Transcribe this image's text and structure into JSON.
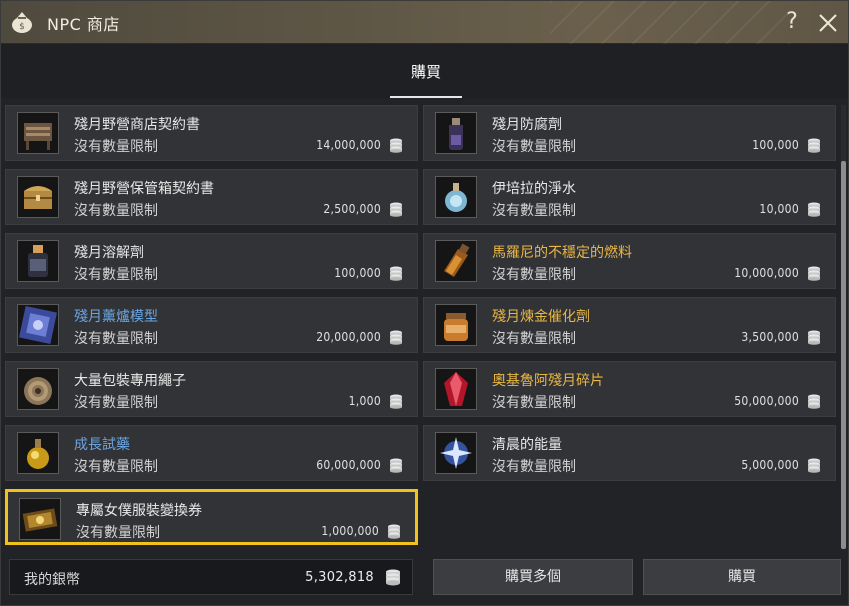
{
  "window": {
    "title": "NPC 商店",
    "help_label": "?",
    "title_icon": "coin-bag-icon",
    "close_icon": "close-icon"
  },
  "tabs": [
    {
      "label": "購買",
      "active": true
    }
  ],
  "items": [
    {
      "name": "殘月野營商店契約書",
      "limit": "沒有數量限制",
      "price": "14,000,000",
      "name_color": "#e8e8e8",
      "icon": "contract-chair-icon"
    },
    {
      "name": "殘月防腐劑",
      "limit": "沒有數量限制",
      "price": "100,000",
      "name_color": "#e8e8e8",
      "icon": "potion-bottle-icon"
    },
    {
      "name": "殘月野營保管箱契約書",
      "limit": "沒有數量限制",
      "price": "2,500,000",
      "name_color": "#e8e8e8",
      "icon": "treasure-chest-icon"
    },
    {
      "name": "伊培拉的淨水",
      "limit": "沒有數量限制",
      "price": "10,000",
      "name_color": "#e8e8e8",
      "icon": "water-flask-icon"
    },
    {
      "name": "殘月溶解劑",
      "limit": "沒有數量限制",
      "price": "100,000",
      "name_color": "#e8e8e8",
      "icon": "solvent-bottle-icon"
    },
    {
      "name": "馬羅尼的不穩定的燃料",
      "limit": "沒有數量限制",
      "price": "10,000,000",
      "name_color": "#e9b743",
      "icon": "fuel-bottle-icon"
    },
    {
      "name": "殘月薰爐模型",
      "limit": "沒有數量限制",
      "price": "20,000,000",
      "name_color": "#6aa5e2",
      "icon": "incense-model-icon"
    },
    {
      "name": "殘月煉金催化劑",
      "limit": "沒有數量限制",
      "price": "3,500,000",
      "name_color": "#e9b743",
      "icon": "catalyst-jar-icon"
    },
    {
      "name": "大量包裝專用繩子",
      "limit": "沒有數量限制",
      "price": "1,000",
      "name_color": "#e8e8e8",
      "icon": "rope-coil-icon"
    },
    {
      "name": "奧基魯阿殘月碎片",
      "limit": "沒有數量限制",
      "price": "50,000,000",
      "name_color": "#e9b743",
      "icon": "red-crystal-icon"
    },
    {
      "name": "成長試藥",
      "limit": "沒有數量限制",
      "price": "60,000,000",
      "name_color": "#6aa5e2",
      "icon": "growth-elixir-icon"
    },
    {
      "name": "清晨的能量",
      "limit": "沒有數量限制",
      "price": "5,000,000",
      "name_color": "#e8e8e8",
      "icon": "energy-spark-icon"
    },
    {
      "name": "專屬女僕服裝變換券",
      "limit": "沒有數量限制",
      "price": "1,000,000",
      "name_color": "#e8e8e8",
      "icon": "costume-ticket-icon",
      "selected": true
    }
  ],
  "footer": {
    "wallet_label": "我的銀幣",
    "wallet_amount": "5,302,818",
    "wallet_icon": "silver-coin-stack-icon",
    "buy_multiple_label": "購買多個",
    "buy_label": "購買"
  },
  "colors": {
    "selected_border": "#f1c21b",
    "rare_name": "#e9b743",
    "uncommon_name": "#6aa5e2"
  }
}
